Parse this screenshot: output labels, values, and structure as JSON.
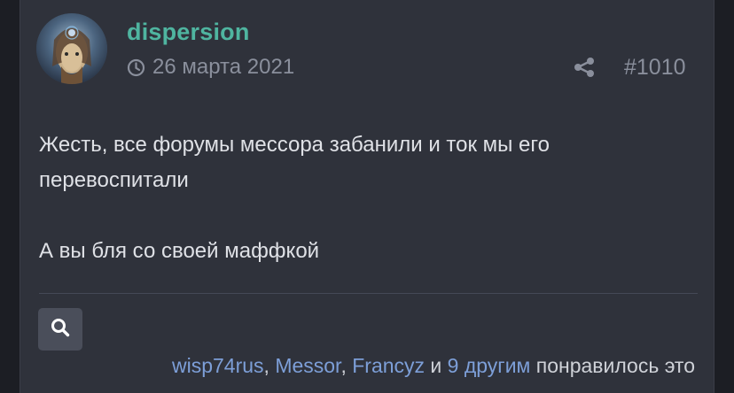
{
  "post": {
    "author": "dispersion",
    "date": "26 марта 2021",
    "post_number": "#1010",
    "paragraphs": [
      "Жесть, все форумы мессора забанили и ток мы его перевоспитали",
      "А вы бля со своей маффкой"
    ]
  },
  "icons": {
    "clock": "clock-icon",
    "share": "share-icon",
    "search": "search-icon"
  },
  "reactions": {
    "users": [
      "wisp74rus",
      "Messor",
      "Francyz"
    ],
    "comma": ",",
    "and": "и",
    "others": "9 другим",
    "suffix": "понравилось это"
  },
  "colors": {
    "background": "#2f323b",
    "username": "#4fb5a0",
    "link": "#7d9fd8",
    "muted": "#8a8f9c",
    "text": "#dfe1e6"
  }
}
